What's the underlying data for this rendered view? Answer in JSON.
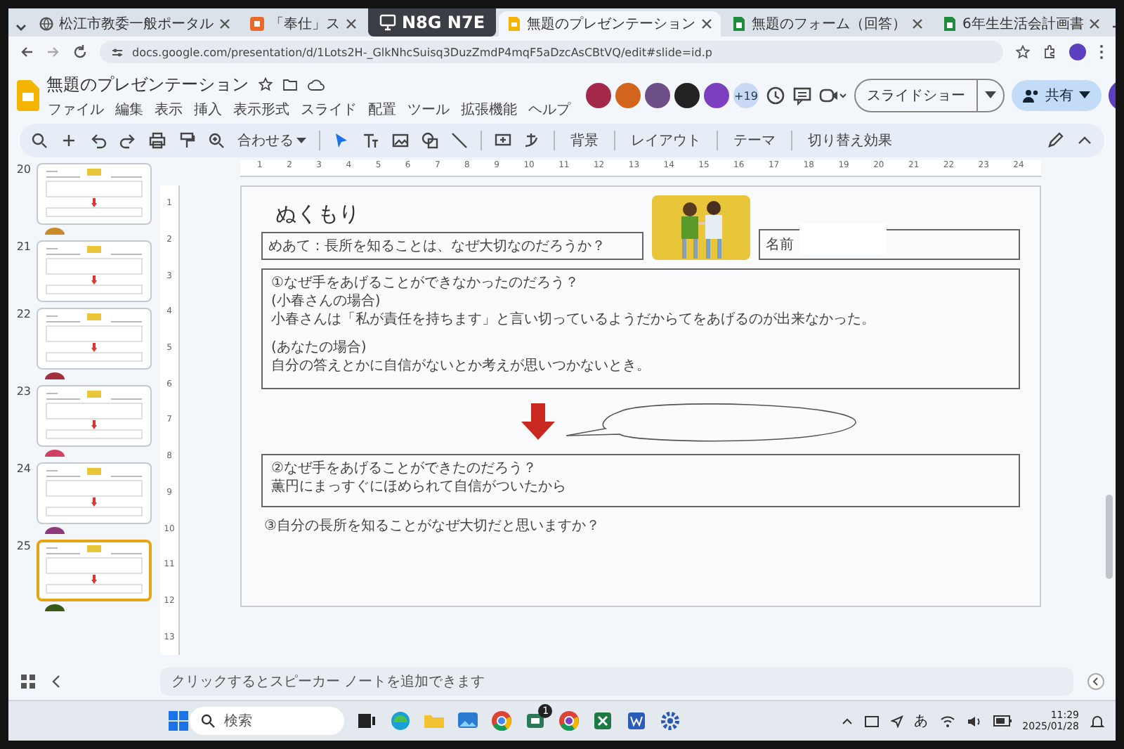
{
  "browser": {
    "tabs": [
      {
        "kind": "globe",
        "title": "松江市教委一般ポータル",
        "selected": false
      },
      {
        "kind": "app",
        "title": "「奉仕」ス",
        "selected": false
      },
      {
        "kind": "slides",
        "title": "無題のプレゼンテーション",
        "selected": true
      },
      {
        "kind": "sheets",
        "title": "無題のフォーム（回答）",
        "selected": false
      },
      {
        "kind": "sheets",
        "title": "6年生生活会計画書",
        "selected": false
      }
    ],
    "meeting_code": "N8G N7E",
    "url": "docs.google.com/presentation/d/1Lots2H-_GlkNhcSuisq3DuzZmdP4mqF5aDzcAsCBtVQ/edit#slide=id.p"
  },
  "docs": {
    "title": "無題のプレゼンテーション",
    "menu": [
      "ファイル",
      "編集",
      "表示",
      "挿入",
      "表示形式",
      "スライド",
      "配置",
      "ツール",
      "拡張機能",
      "ヘルプ"
    ],
    "collaborators": [
      {
        "color": "#a3294a"
      },
      {
        "color": "#d2641e"
      },
      {
        "color": "#6b4f86"
      },
      {
        "color": "#222222"
      },
      {
        "color": "#7b3fbf"
      }
    ],
    "more_count": "+19",
    "slideshow_button": "スライドショー",
    "share_button": "共有"
  },
  "toolbar": {
    "zoom": "合わせる",
    "buttons": [
      "背景",
      "レイアウト",
      "テーマ",
      "切り替え効果"
    ]
  },
  "ruler": [
    "1",
    "2",
    "3",
    "4",
    "5",
    "6",
    "7",
    "8",
    "9",
    "10",
    "11",
    "12",
    "13",
    "14",
    "15",
    "16",
    "17",
    "18",
    "19",
    "20",
    "21",
    "22",
    "23",
    "24"
  ],
  "vertical_ruler": [
    "1",
    "2",
    "3",
    "4",
    "5",
    "6",
    "7",
    "8",
    "9",
    "10",
    "11",
    "12",
    "13"
  ],
  "filmstrip": [
    {
      "number": "20",
      "selected": false,
      "color": "#c98a2a"
    },
    {
      "number": "21",
      "selected": false
    },
    {
      "number": "22",
      "selected": false,
      "color": "#a03040"
    },
    {
      "number": "23",
      "selected": false,
      "color": "#d04060"
    },
    {
      "number": "24",
      "selected": false,
      "color": "#8a3a7a"
    },
    {
      "number": "25",
      "selected": true,
      "color": "#3a5a1a"
    }
  ],
  "slide": {
    "title": "ぬくもり",
    "goal": "めあて：長所を知ることは、なぜ大切なのだろうか？",
    "name_label": "名前",
    "box_1": [
      "①なぜ手をあげることができなかったのだろう？",
      "(小春さんの場合)",
      "小春さんは「私が責任を持ちます」と言い切っているようだからてをあげるのが出来なかった。",
      "(あなたの場合)",
      "自分の答えとかに自信がないとか考えが思いつかないとき。"
    ],
    "box_2": [
      "②なぜ手をあげることができたのだろう？",
      "薫円にまっすぐにほめられて自信がついたから"
    ],
    "question_3": "③自分の長所を知ることがなぜ大切だと思いますか？"
  },
  "speaker_notes": {
    "placeholder": "クリックするとスピーカー ノートを追加できます"
  },
  "taskbar": {
    "search": {
      "placeholder": "検索"
    },
    "badge": "1",
    "ime": "あ",
    "time": "11:29",
    "date": "2025/01/28"
  }
}
